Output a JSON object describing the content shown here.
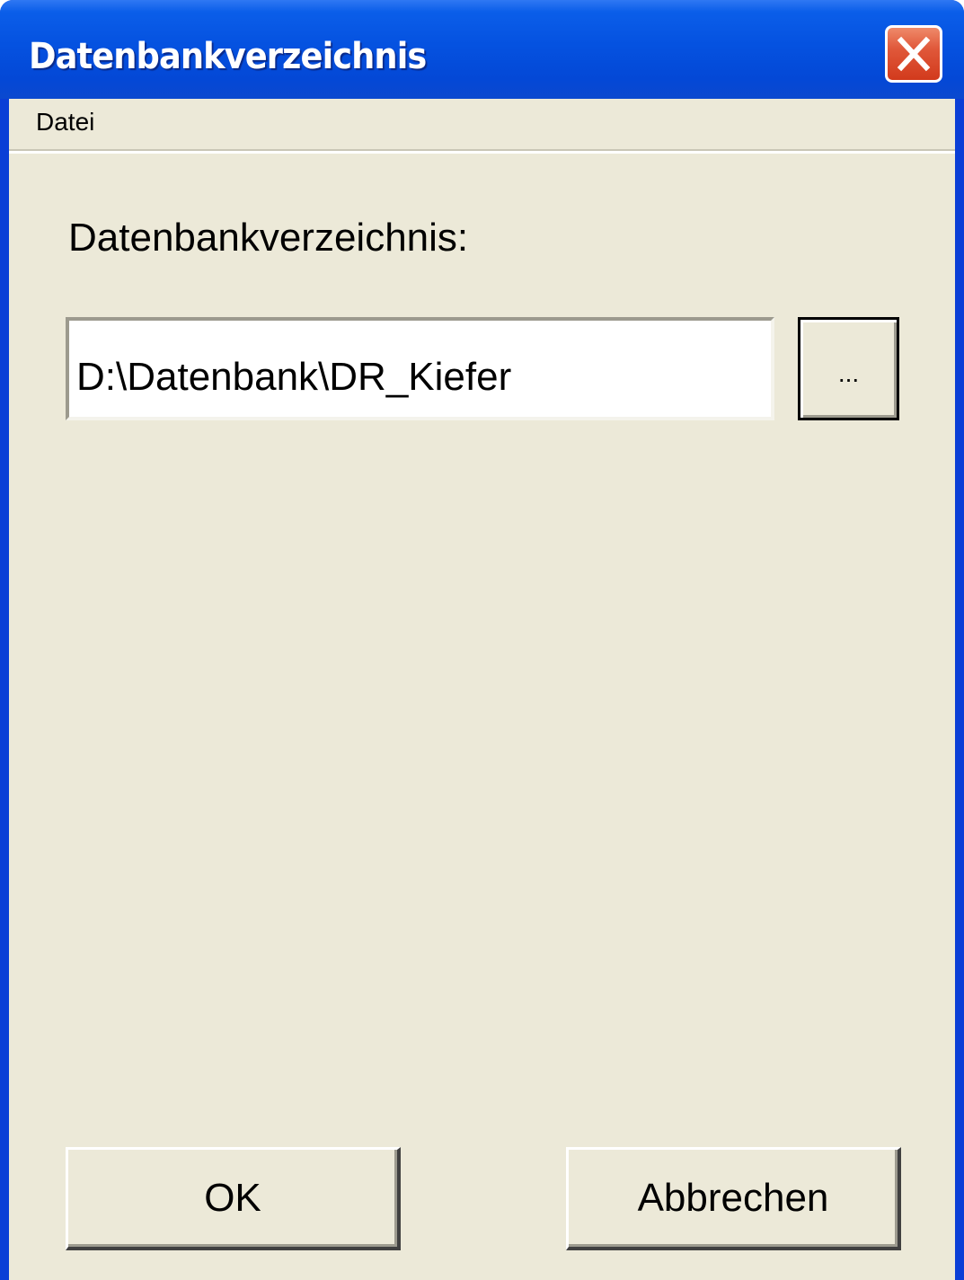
{
  "window": {
    "title": "Datenbankverzeichnis",
    "close_icon": "close-icon"
  },
  "menubar": {
    "items": [
      {
        "label": "Datei"
      }
    ]
  },
  "main": {
    "label": "Datenbankverzeichnis:",
    "path_value": "D:\\Datenbank\\DR_Kiefer",
    "browse_label": "..."
  },
  "buttons": {
    "ok_label": "OK",
    "cancel_label": "Abbrechen"
  },
  "colors": {
    "titlebar": "#0552e0",
    "client_bg": "#ece9d8",
    "close_red": "#d23a1c"
  }
}
